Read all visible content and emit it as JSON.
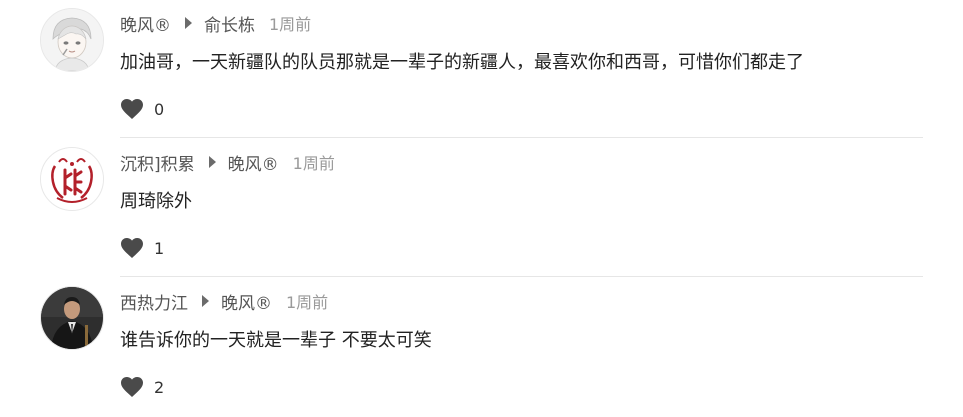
{
  "comments": [
    {
      "author": "晚风®",
      "reply_to": "俞长栋",
      "time": "1周前",
      "text": "加油哥，一天新疆队的队员那就是一辈子的新疆人，最喜欢你和西哥，可惜你们都走了",
      "likes": "0",
      "avatar_icon": "anime-boy-avatar"
    },
    {
      "author": "沉积]积累",
      "reply_to": "晚风®",
      "time": "1周前",
      "text": "周琦除外",
      "likes": "1",
      "avatar_icon": "team-logo-avatar"
    },
    {
      "author": "西热力江",
      "reply_to": "晚风®",
      "time": "1周前",
      "text": "谁告诉你的一天就是一辈子 不要太可笑",
      "likes": "2",
      "avatar_icon": "man-in-suit-avatar"
    }
  ],
  "colors": {
    "like_icon": "#4a4a4a",
    "time": "#9a9a9a",
    "logo_red": "#b3202a"
  }
}
